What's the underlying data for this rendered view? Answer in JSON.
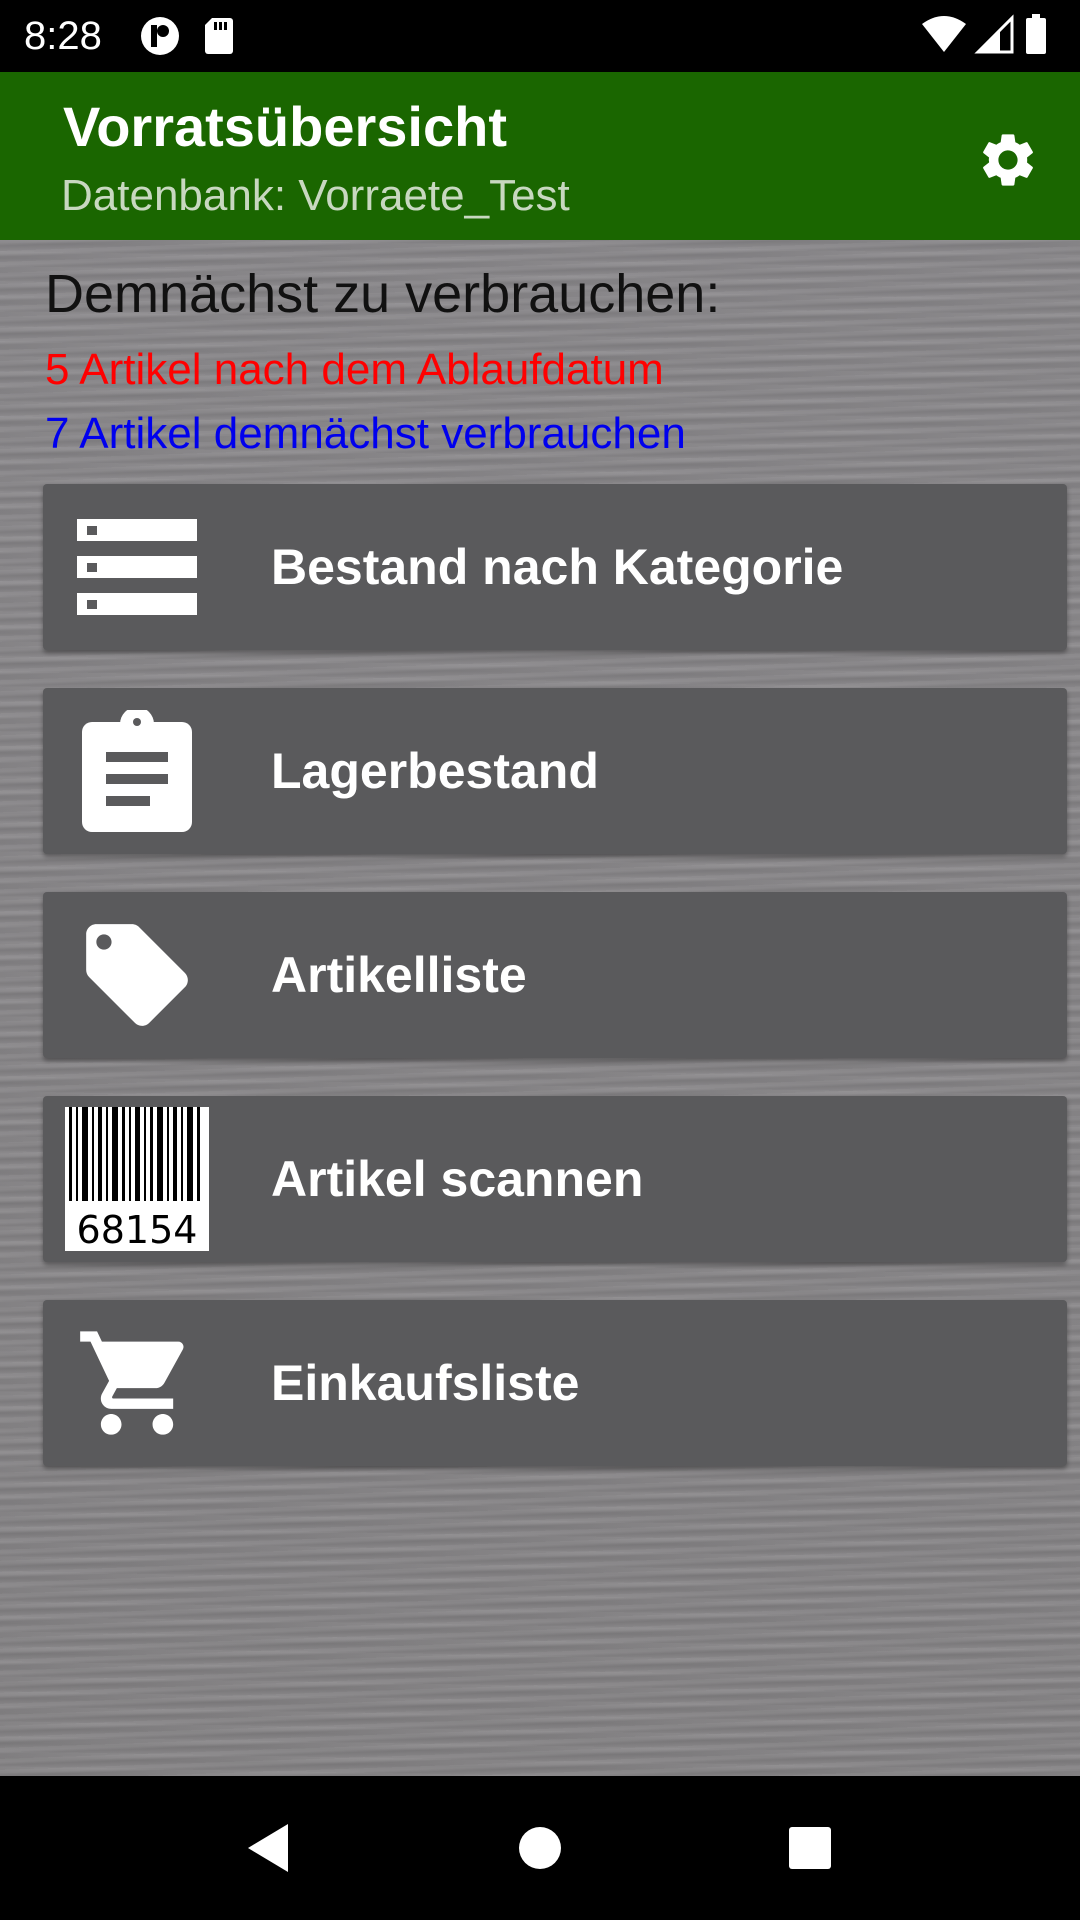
{
  "status_bar": {
    "time": "8:28",
    "left_icons": [
      "app-notification-icon",
      "sd-card-icon"
    ],
    "right_icons": [
      "wifi-icon",
      "cell-signal-icon",
      "battery-icon"
    ]
  },
  "app_bar": {
    "title": "Vorratsübersicht",
    "subtitle": "Datenbank: Vorraete_Test",
    "settings_icon": "gear-icon",
    "color": "#1a6600"
  },
  "summary": {
    "heading": "Demnächst zu verbrauchen:",
    "expired": "5 Artikel nach dem Ablaufdatum",
    "soon": "7 Artikel demnächst verbrauchen",
    "expired_color": "#ff0000",
    "soon_color": "#0000ee"
  },
  "menu": {
    "items": [
      {
        "label": "Bestand nach Kategorie",
        "icon": "list-icon"
      },
      {
        "label": "Lagerbestand",
        "icon": "clipboard-icon"
      },
      {
        "label": "Artikelliste",
        "icon": "tag-icon"
      },
      {
        "label": "Artikel scannen",
        "icon": "barcode-icon",
        "barcode_number": "68154"
      },
      {
        "label": "Einkaufsliste",
        "icon": "shopping-cart-icon"
      }
    ]
  },
  "nav_bar": {
    "buttons": [
      "back-icon",
      "home-icon",
      "recents-icon"
    ]
  }
}
